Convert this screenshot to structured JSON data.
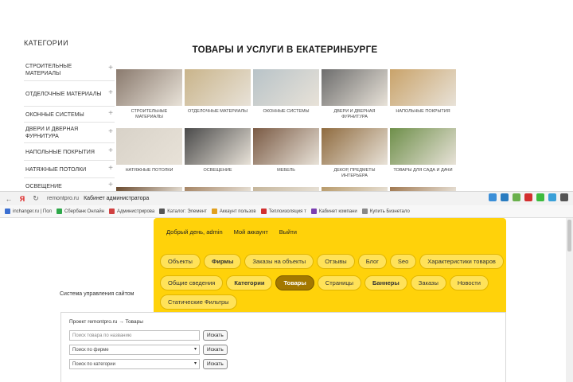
{
  "site": {
    "categories_title": "КАТЕГОРИИ",
    "page_title": "ТОВАРЫ И УСЛУГИ В ЕКАТЕРИНБУРГЕ",
    "categories": [
      {
        "label": "СТРОИТЕЛЬНЫЕ МАТЕРИАЛЫ"
      },
      {
        "label": "ОТДЕЛОЧНЫЕ МАТЕРИАЛЫ"
      },
      {
        "label": "ОКОННЫЕ СИСТЕМЫ"
      },
      {
        "label": "ДВЕРИ И ДВЕРНАЯ ФУРНИТУРА"
      },
      {
        "label": "НАПОЛЬНЫЕ ПОКРЫТИЯ"
      },
      {
        "label": "НАТЯЖНЫЕ ПОТОЛКИ"
      },
      {
        "label": "ОСВЕЩЕНИЕ"
      }
    ],
    "plus_glyph": "+",
    "tiles_row1": [
      {
        "caption": "СТРОИТЕЛЬНЫЕ МАТЕРИАЛЫ",
        "color": "#8a7a6e"
      },
      {
        "caption": "ОТДЕЛОЧНЫЕ МАТЕРИАЛЫ",
        "color": "#c9b48a"
      },
      {
        "caption": "ОКОННЫЕ СИСТЕМЫ",
        "color": "#b8c3c8"
      },
      {
        "caption": "ДВЕРИ И ДВЕРНАЯ ФУРНИТУРА",
        "color": "#6d6d6d"
      },
      {
        "caption": "НАПОЛЬНЫЕ ПОКРЫТИЯ",
        "color": "#c9a36a"
      }
    ],
    "tiles_row2": [
      {
        "caption": "НАТЯЖНЫЕ ПОТОЛКИ",
        "color": "#d8d2c8"
      },
      {
        "caption": "ОСВЕЩЕНИЕ",
        "color": "#4a4a4a"
      },
      {
        "caption": "МЕБЕЛЬ",
        "color": "#7a5a44"
      },
      {
        "caption": "ДЕКОР, ПРЕДМЕТЫ ИНТЕРЬЕРА",
        "color": "#8f6b3f"
      },
      {
        "caption": "ТОВАРЫ ДЛЯ САДА И ДАЧИ",
        "color": "#6e8f4a"
      }
    ],
    "tiles_row3": [
      {
        "color": "#6a4a2e"
      },
      {
        "color": "#a58464"
      },
      {
        "color": "#c5b59a"
      },
      {
        "color": "#b89a6a"
      },
      {
        "color": "#a07850"
      }
    ]
  },
  "browser": {
    "back_glyph": "←",
    "yandex_glyph": "Я",
    "reload_glyph": "↻",
    "url": "remontpro.ru",
    "tab_title": "Кабинет администратора",
    "bookmarks": [
      {
        "label": "inchanger.ru | Пол",
        "color": "#3b6fd1"
      },
      {
        "label": "Сбербанк Онлайн",
        "color": "#2ea84a"
      },
      {
        "label": "Администрирова",
        "color": "#d04040"
      },
      {
        "label": "Каталог: Элемент",
        "color": "#555555"
      },
      {
        "label": "Аккаунт пользов",
        "color": "#e0a020"
      },
      {
        "label": "Теплоизоляция т",
        "color": "#d03030"
      },
      {
        "label": "Кабинет компани",
        "color": "#7a3fb0"
      },
      {
        "label": "Купить Бизнетало",
        "color": "#888888"
      }
    ],
    "icons": [
      {
        "name": "mail-icon",
        "color": "#3b8fd8"
      },
      {
        "name": "share-icon",
        "color": "#2a7cc0"
      },
      {
        "name": "android-icon",
        "color": "#6ab04c"
      },
      {
        "name": "adblock-icon",
        "color": "#d32f2f"
      },
      {
        "name": "wechat-icon",
        "color": "#3dbb3d"
      },
      {
        "name": "extension-icon",
        "color": "#3aa0d8"
      },
      {
        "name": "download-icon",
        "color": "#555555"
      }
    ]
  },
  "admin": {
    "greeting": "Добрый день, admin",
    "my_account": "Мой аккаунт",
    "logout": "Выйти",
    "menu_row1": [
      {
        "label": "Объекты",
        "bold": false
      },
      {
        "label": "Фирмы",
        "bold": true
      },
      {
        "label": "Заказы на объекты",
        "bold": false
      },
      {
        "label": "Отзывы",
        "bold": false
      },
      {
        "label": "Блог",
        "bold": false
      },
      {
        "label": "Seo",
        "bold": false
      },
      {
        "label": "Характеристики товаров",
        "bold": false
      }
    ],
    "menu_row2": [
      {
        "label": "Общие сведения",
        "bold": false,
        "active": false
      },
      {
        "label": "Категории",
        "bold": true,
        "active": false
      },
      {
        "label": "Товары",
        "bold": true,
        "active": true
      },
      {
        "label": "Страницы",
        "bold": false,
        "active": false
      },
      {
        "label": "Баннеры",
        "bold": true,
        "active": false
      },
      {
        "label": "Заказы",
        "bold": false,
        "active": false
      },
      {
        "label": "Новости",
        "bold": false,
        "active": false
      },
      {
        "label": "Статические Фильтры",
        "bold": false,
        "active": false
      }
    ],
    "system_label": "Система управления сайтом",
    "breadcrumb": "Проект remontpro.ru → Товары",
    "search_placeholder": "Поиск товара по названию",
    "firm_select": "Поиск по фирме",
    "category_select": "Поиск по категории",
    "search_button": "Искать",
    "arrow_glyph": "▾"
  }
}
